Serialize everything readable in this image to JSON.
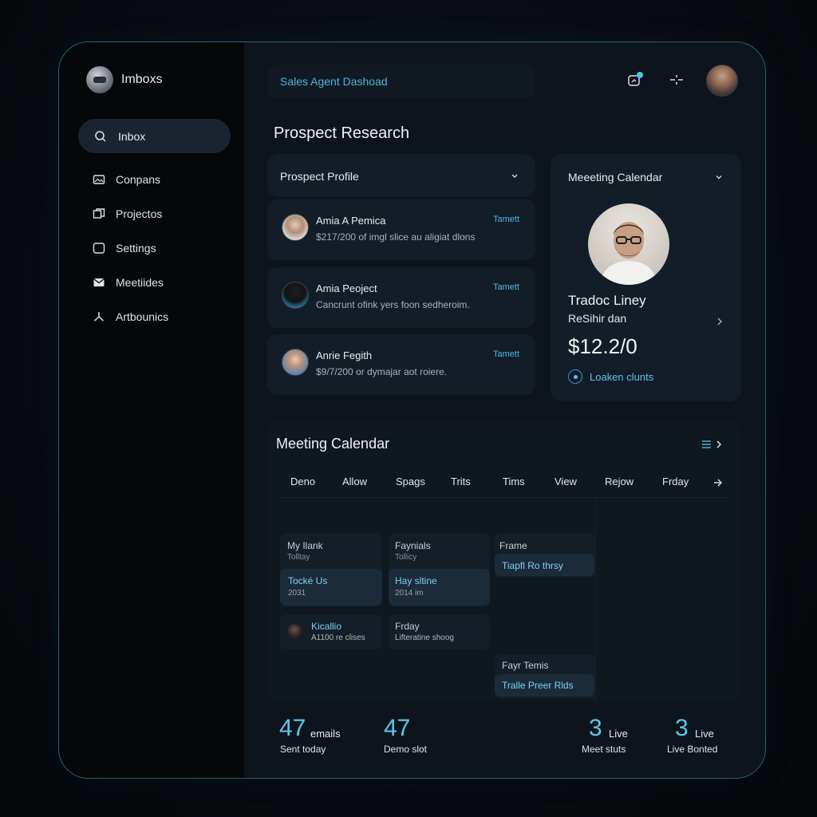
{
  "sidebar": {
    "brand": "Imboxs",
    "active_item": "Inbox",
    "items": [
      {
        "label": "Conpans",
        "icon": "image-icon"
      },
      {
        "label": "Projectos",
        "icon": "folders-icon"
      },
      {
        "label": "Settings",
        "icon": "square-icon"
      },
      {
        "label": "Meetiides",
        "icon": "mail-icon"
      },
      {
        "label": "Artbounics",
        "icon": "share-icon"
      }
    ]
  },
  "header": {
    "search_text": "Sales Agent Dashoad"
  },
  "page_title": "Prospect Research",
  "prospect_profile": {
    "title": "Prospect Profile",
    "items": [
      {
        "name": "Amia A Pemica",
        "desc": "$217/200 of imgl slice au aligiat dlons",
        "tag": "Tamett"
      },
      {
        "name": "Amia Peoject",
        "desc": "Cancrunt ofink yers foon sedheroim.",
        "tag": "Tamett"
      },
      {
        "name": "Anrie Fegith",
        "desc": "$9/7/200 or dymajar aot roiere.",
        "tag": "Tamett"
      }
    ]
  },
  "meeting_card": {
    "title": "Meeeting Calendar",
    "name": "Tradoc Liney",
    "role": "ReSihir dan",
    "amount": "$12.2/0",
    "link": "Loaken clunts"
  },
  "calendar": {
    "title": "Meeting Calendar",
    "days": [
      "Deno",
      "Allow",
      "Spags",
      "Trits",
      "Tims",
      "View",
      "Rejow",
      "Frday"
    ],
    "events": {
      "a_title": "My Ilank",
      "a_sub": "Tolltay",
      "a_hi_title": "Tocké Us",
      "a_hi_sub": "2031",
      "b_title": "Faynials",
      "b_sub": "Tollicy",
      "b_hi_title": "Hay sltine",
      "b_hi_sub": "2014 im",
      "c_title": "Frame",
      "c_hi": "Tiapfl Ro thrsy",
      "d_title": "Kicallio",
      "d_sub": "A1100 re clises",
      "e_title": "Frday",
      "e_sub": "Lifteratine shoog",
      "f_title": "Fayr Temis",
      "f_hi": "Tralle Preer Rlds"
    }
  },
  "stats": [
    {
      "num": "47",
      "unit": "emails",
      "label": "Sent today"
    },
    {
      "num": "47",
      "unit": "",
      "label": "Demo slot"
    },
    {
      "num": "3",
      "unit": "Live",
      "label": "Meet stuts"
    },
    {
      "num": "3",
      "unit": "Live",
      "label": "Live Bonted"
    }
  ],
  "colors": {
    "accent": "#4fb3d9",
    "background": "#0c1219",
    "card": "#131d27"
  }
}
